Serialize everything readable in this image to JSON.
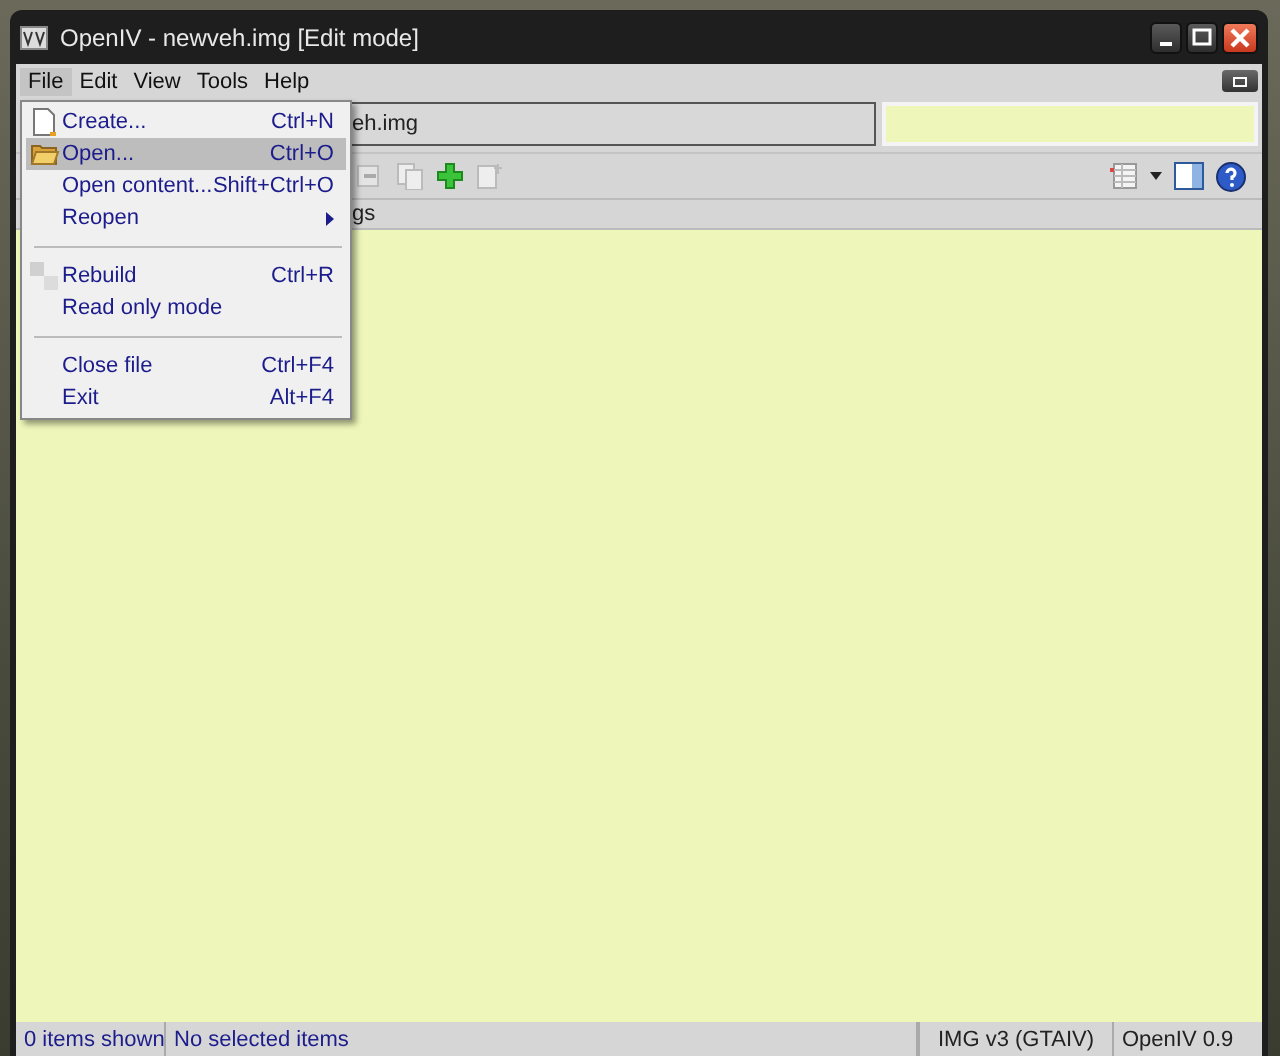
{
  "window": {
    "title": "OpenIV - newveh.img [Edit mode]"
  },
  "menu_bar": [
    {
      "label": "File",
      "selected": true
    },
    {
      "label": "Edit",
      "selected": false
    },
    {
      "label": "View",
      "selected": false
    },
    {
      "label": "Tools",
      "selected": false
    },
    {
      "label": "Help",
      "selected": false
    }
  ],
  "file_menu": [
    {
      "kind": "item",
      "label": "Create...",
      "shortcut": "Ctrl+N",
      "selected": false
    },
    {
      "kind": "item",
      "label": "Open...",
      "shortcut": "Ctrl+O",
      "selected": true
    },
    {
      "kind": "item",
      "label": "Open content...",
      "shortcut": "Shift+Ctrl+O",
      "selected": false
    },
    {
      "kind": "submenu",
      "label": "Reopen",
      "selected": false
    },
    {
      "kind": "separator"
    },
    {
      "kind": "item",
      "label": "Rebuild",
      "shortcut": "Ctrl+R",
      "selected": false
    },
    {
      "kind": "item",
      "label": "Read only mode",
      "selected": false
    },
    {
      "kind": "separator"
    },
    {
      "kind": "item",
      "label": "Close file",
      "shortcut": "Ctrl+F4",
      "selected": false
    },
    {
      "kind": "item",
      "label": "Exit",
      "shortcut": "Alt+F4",
      "selected": false
    }
  ],
  "path_field": {
    "value": "eh.img"
  },
  "column_header": {
    "label": "gs"
  },
  "status_bar": [
    "0 items shown",
    "No selected items",
    "IMG v3 (GTAIV)",
    "OpenIV 0.9"
  ]
}
